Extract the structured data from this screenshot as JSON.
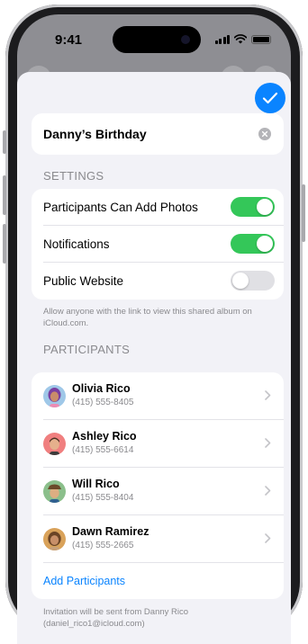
{
  "status_bar": {
    "time": "9:41"
  },
  "album": {
    "name": "Danny’s Birthday"
  },
  "settings": {
    "header": "SETTINGS",
    "rows": [
      {
        "label": "Participants Can Add Photos",
        "enabled": true
      },
      {
        "label": "Notifications",
        "enabled": true
      },
      {
        "label": "Public Website",
        "enabled": false
      }
    ],
    "footer": "Allow anyone with the link to view this shared album on iCloud.com."
  },
  "participants": {
    "header": "PARTICIPANTS",
    "people": [
      {
        "name": "Olivia Rico",
        "phone": "(415) 555-8405"
      },
      {
        "name": "Ashley Rico",
        "phone": "(415) 555-6614"
      },
      {
        "name": "Will Rico",
        "phone": "(415) 555-8404"
      },
      {
        "name": "Dawn Ramirez",
        "phone": "(415) 555-2665"
      }
    ],
    "add_label": "Add Participants",
    "footer": "Invitation will be sent from Danny Rico (daniel_rico1@icloud.com)"
  },
  "colors": {
    "accent": "#0a84ff",
    "toggle_on": "#34c759",
    "toggle_off": "#e0e0e4"
  },
  "icons": [
    "checkmark-icon",
    "clear-icon",
    "chevron-right-icon",
    "memoji-avatar"
  ]
}
